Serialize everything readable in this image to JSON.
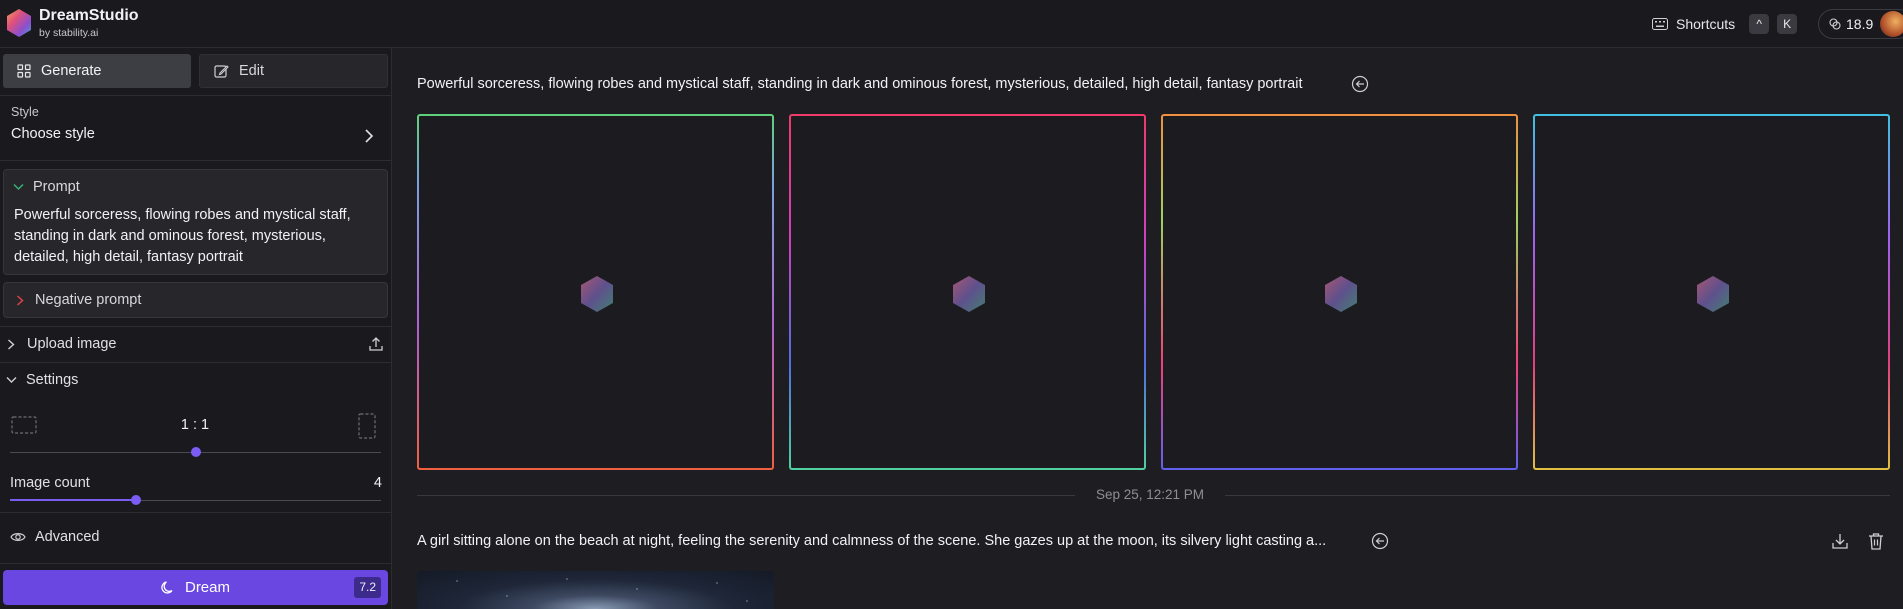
{
  "app": {
    "name": "DreamStudio",
    "byline": "by stability.ai"
  },
  "topbar": {
    "shortcuts_label": "Shortcuts",
    "shortcut_keys": [
      "^",
      "K"
    ],
    "credits": "18.9"
  },
  "sidebar": {
    "tabs": [
      {
        "label": "Generate",
        "icon": "grid-icon",
        "active": true
      },
      {
        "label": "Edit",
        "icon": "edit-icon",
        "active": false
      }
    ],
    "style": {
      "label": "Style",
      "value": "Choose style"
    },
    "prompt": {
      "label": "Prompt",
      "text": "Powerful sorceress, flowing robes and mystical staff, standing in dark and ominous forest, mysterious, detailed, high detail, fantasy portrait"
    },
    "negative_prompt": {
      "label": "Negative prompt"
    },
    "upload_image": {
      "label": "Upload image"
    },
    "settings": {
      "label": "Settings",
      "aspect_ratio": "1:1",
      "aspect_ratio_display": "1 : 1",
      "aspect_slider_fraction": 0.5,
      "image_count_label": "Image count",
      "image_count": "4",
      "image_count_fraction": 0.34
    },
    "advanced": {
      "label": "Advanced"
    },
    "dream_button": {
      "label": "Dream",
      "cost": "7.2"
    }
  },
  "main": {
    "generations": [
      {
        "prompt": "Powerful sorceress, flowing robes and mystical staff, standing in dark and ominous forest, mysterious, detailed, high detail, fantasy portrait",
        "images": [
          "loading",
          "loading",
          "loading",
          "loading"
        ]
      },
      {
        "prompt": "A girl sitting alone on the beach at night, feeling the serenity and calmness of the scene. She gazes up at the moon, its silvery light casting a...",
        "timestamp": "Sep 25, 12:21 PM"
      }
    ]
  },
  "colors": {
    "accent": "#6a47e0",
    "background": "#1e1e22",
    "sidebar": "#1a1a1e"
  }
}
